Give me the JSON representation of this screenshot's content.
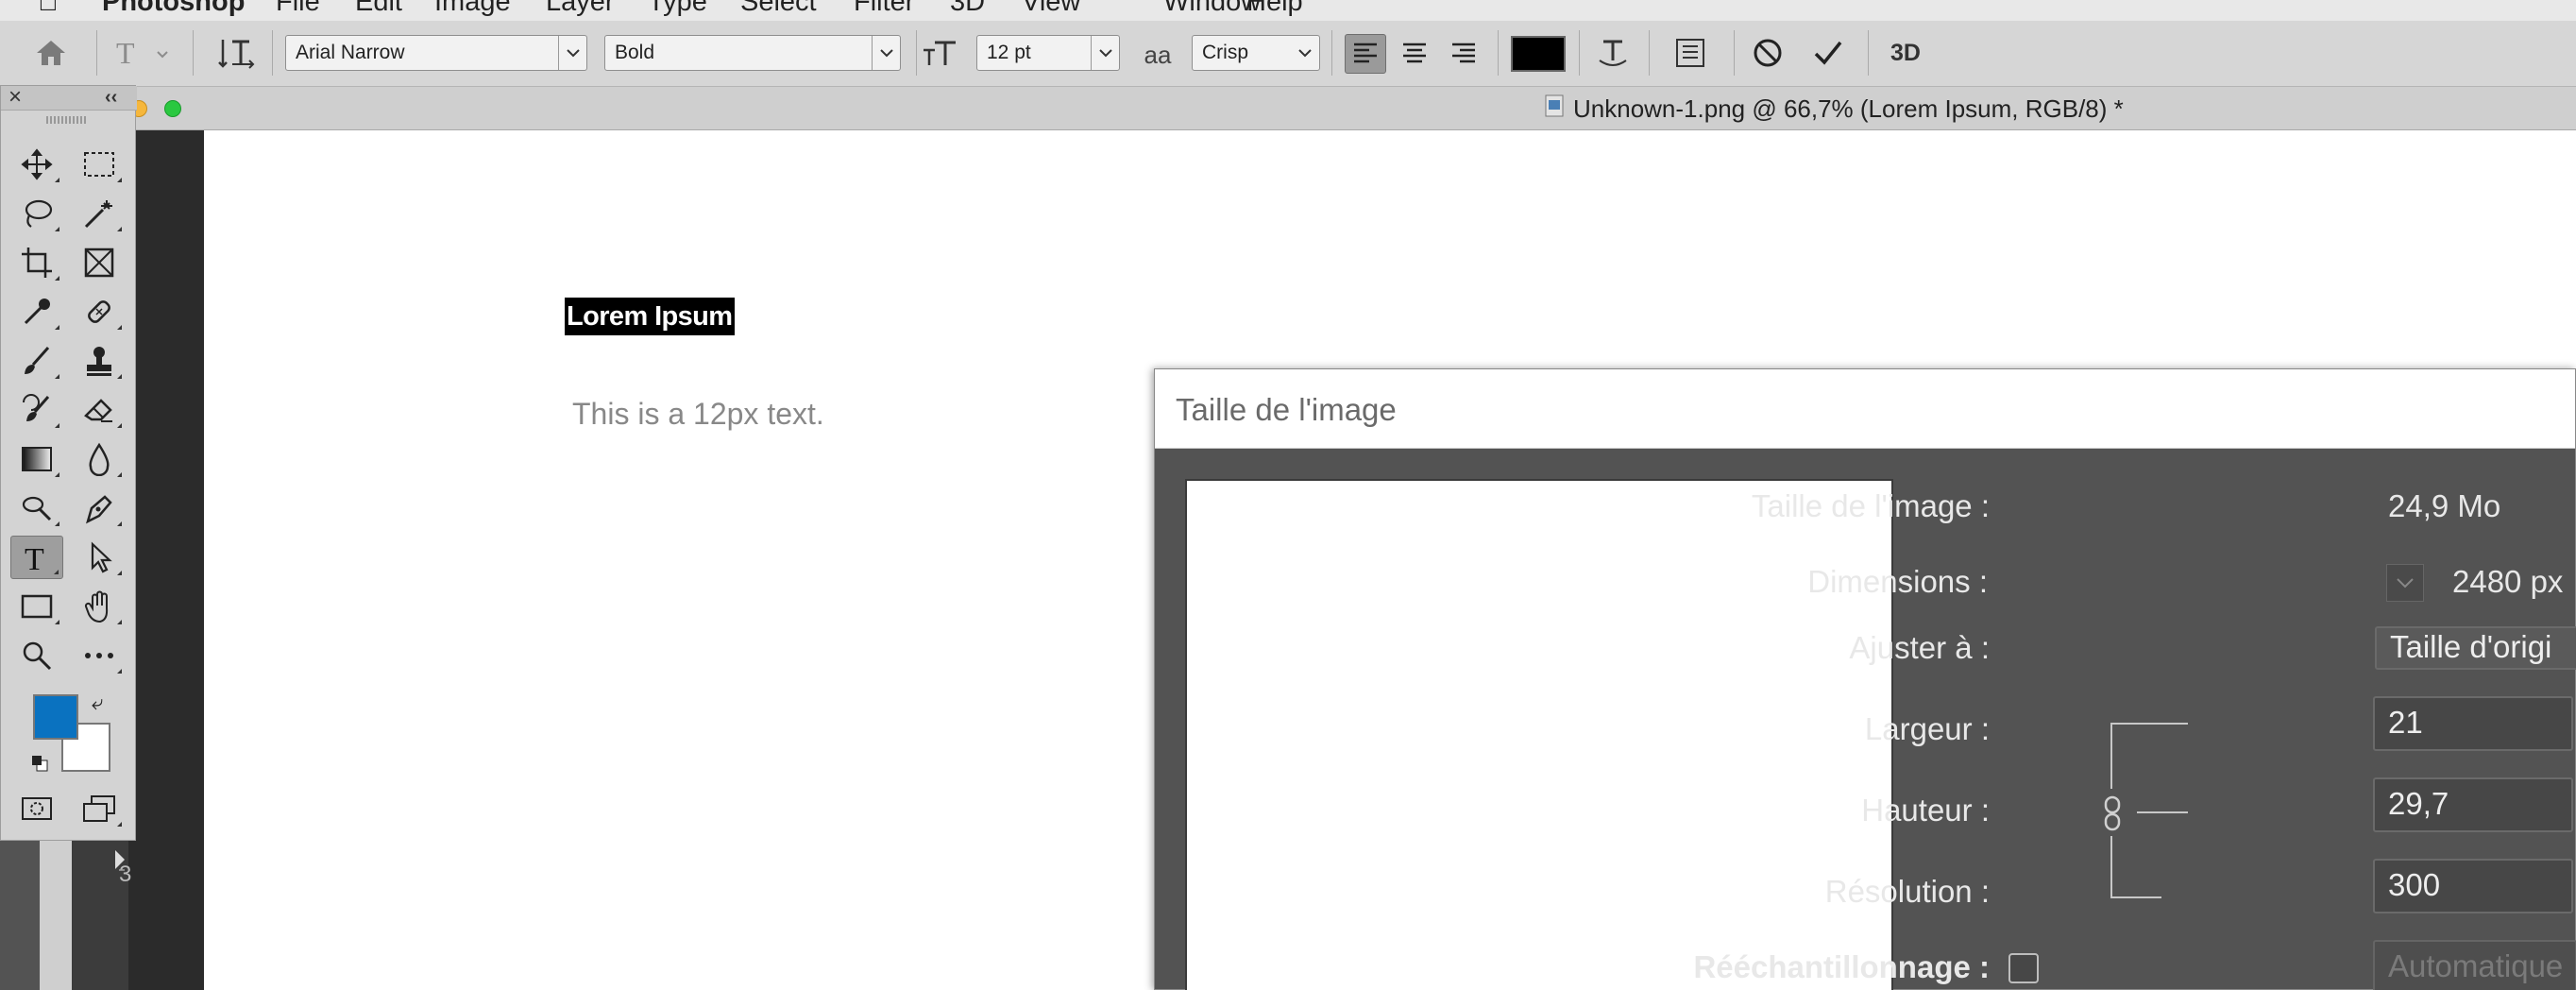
{
  "menubar": {
    "apple": "",
    "items": [
      "Photoshop",
      "File",
      "Edit",
      "Image",
      "Layer",
      "Type",
      "Select",
      "Filter",
      "3D",
      "View",
      "Window",
      "Help"
    ]
  },
  "options_bar": {
    "font_family": "Arial Narrow",
    "font_style": "Bold",
    "font_size": "12 pt",
    "antialias_label": "aa",
    "antialias": "Crisp",
    "text_color": "#000000",
    "three_d": "3D"
  },
  "document": {
    "tab_title": "Unknown-1.png @ 66,7% (Lorem Ipsum, RGB/8) *",
    "selected_text": "Lorem Ipsum",
    "body_text": "This is a 12px text.",
    "ruler_mark": "3"
  },
  "tools": {
    "active": "type-tool",
    "foreground_color": "#0a72c0",
    "background_color": "#ffffff"
  },
  "dialog": {
    "title": "Taille de l'image",
    "image_size_label": "Taille de l'image :",
    "image_size_value": "24,9 Mo",
    "dimensions_label": "Dimensions :",
    "dimensions_value": "2480 px",
    "fit_label": "Ajuster à :",
    "fit_value": "Taille d'origi",
    "width_label": "Largeur :",
    "width_value": "21",
    "height_label": "Hauteur :",
    "height_value": "29,7",
    "resolution_label": "Résolution :",
    "resolution_value": "300",
    "resample_label": "Rééchantillonnage :",
    "resample_value": "Automatique"
  }
}
